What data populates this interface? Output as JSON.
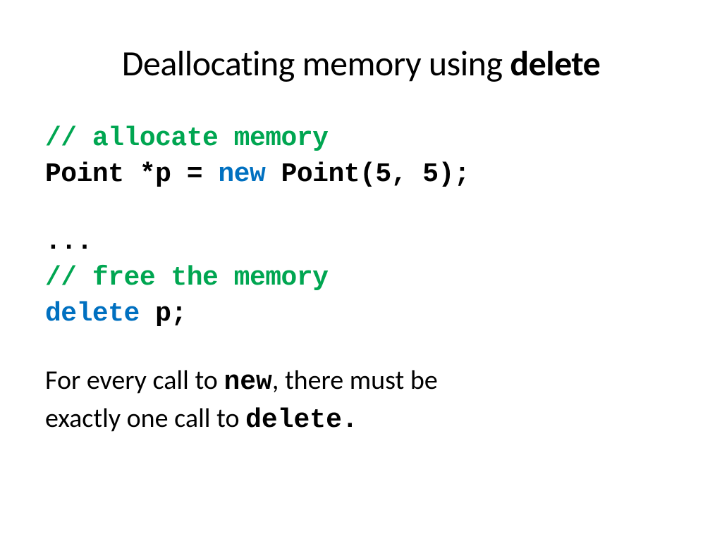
{
  "title": {
    "prefix": "Deallocating memory using ",
    "keyword": "delete"
  },
  "code": {
    "comment1": "// allocate memory",
    "line2a": "Point *p = ",
    "line2kw": "new",
    "line2b": " Point(5, 5);",
    "ellipsis": "...",
    "comment2": "// free the memory",
    "line5kw": "delete",
    "line5b": " p;"
  },
  "prose": {
    "p1a": "For every call to ",
    "p1kw": "new",
    "p1b": ", there must be",
    "p2a": "exactly one call to ",
    "p2kw": "delete.",
    "p2b": ""
  }
}
